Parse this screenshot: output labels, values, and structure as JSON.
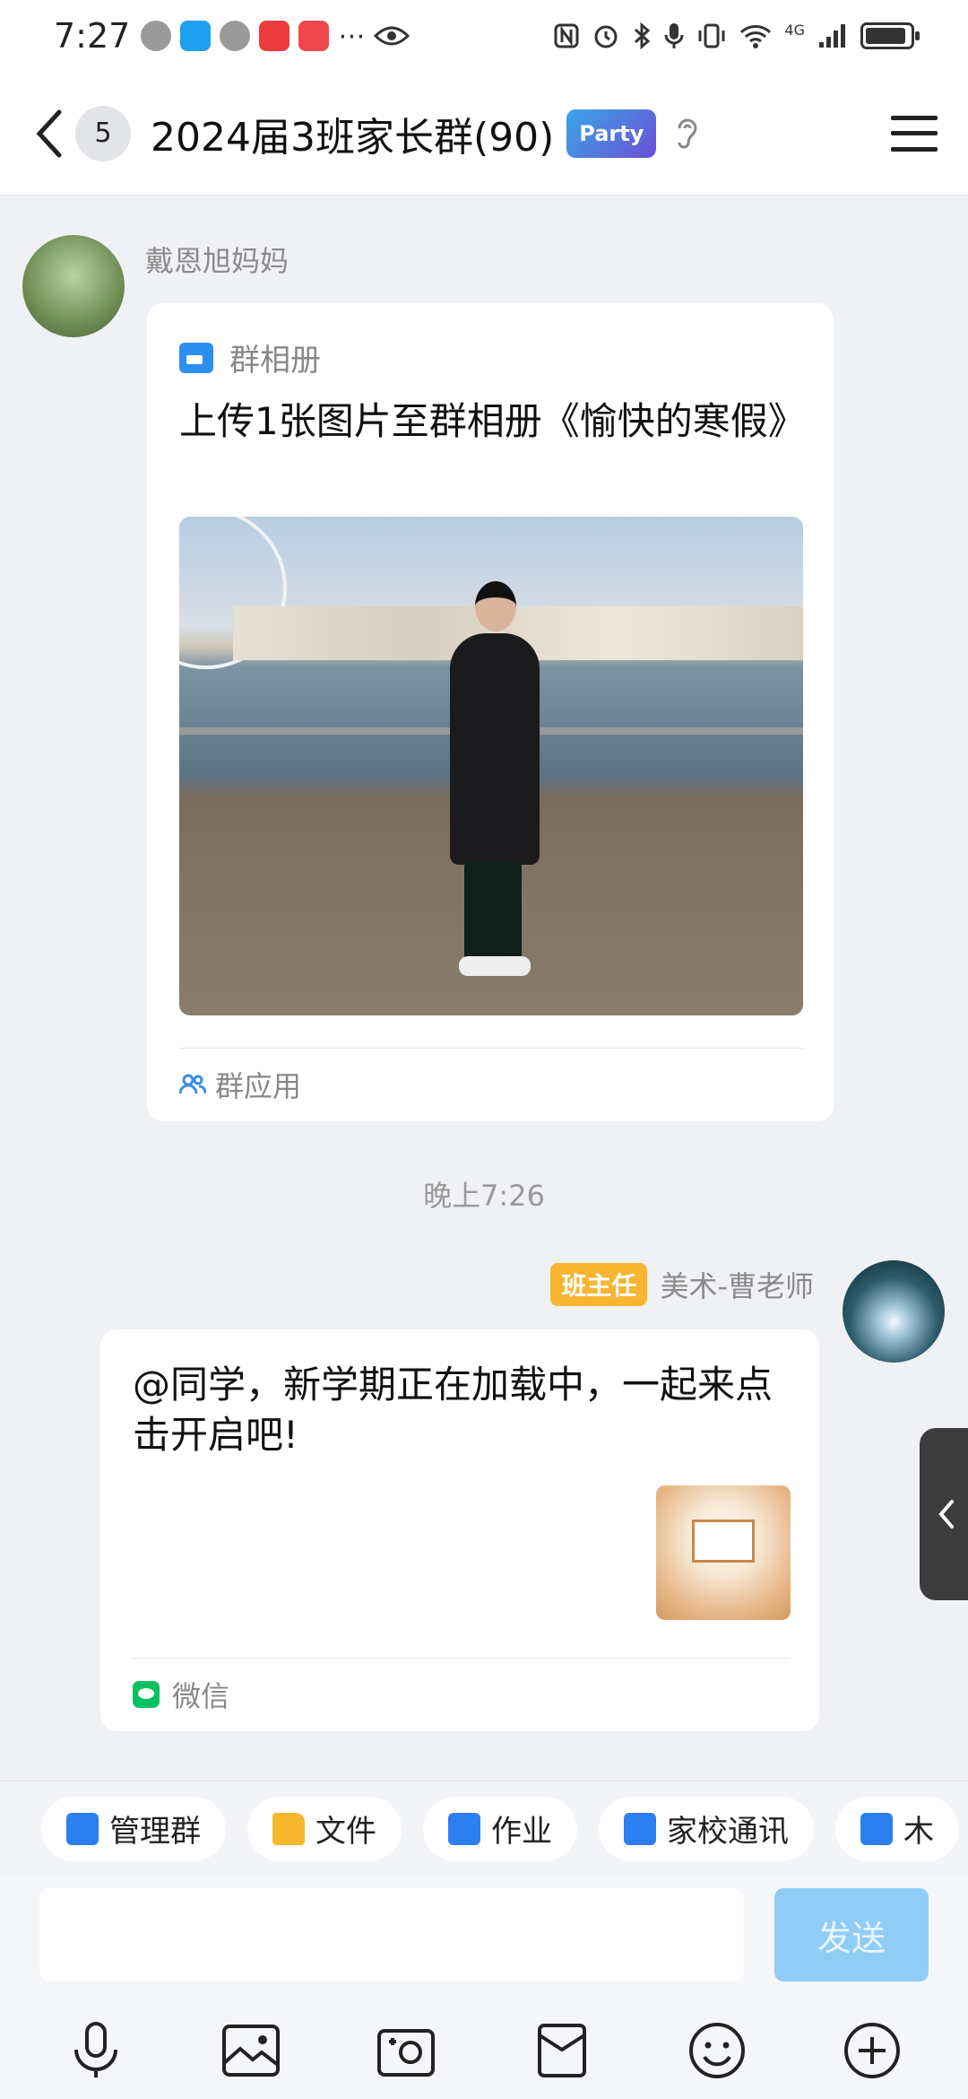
{
  "status_bar": {
    "time": "7:27",
    "right_text": "⋯",
    "network": "4G"
  },
  "nav": {
    "unread_count": "5",
    "title": "2024届3班家长群(90)",
    "badge_text": "Party"
  },
  "messages": {
    "album": {
      "sender": "戴恩旭妈妈",
      "header_label": "群相册",
      "text": "上传1张图片至群相册《愉快的寒假》",
      "footer_label": "群应用"
    },
    "timestamp": "晚上7:26",
    "share": {
      "role_badge": "班主任",
      "sender": "美术-曹老师",
      "text": "@同学，新学期正在加载中，一起来点击开启吧!",
      "footer_label": "微信"
    }
  },
  "quick_actions": [
    {
      "label": "管理群",
      "icon": "manage-group-icon"
    },
    {
      "label": "文件",
      "icon": "folder-icon"
    },
    {
      "label": "作业",
      "icon": "homework-icon"
    },
    {
      "label": "家校通讯",
      "icon": "contacts-icon"
    },
    {
      "label": "木",
      "icon": "album-icon"
    }
  ],
  "composer": {
    "placeholder": "",
    "send_label": "发送"
  },
  "toolbar_icons": [
    "microphone-icon",
    "image-icon",
    "camera-icon",
    "red-packet-icon",
    "emoji-icon",
    "plus-icon"
  ],
  "colors": {
    "accent": "#2b8ef0",
    "send_disabled": "#8fcdf7",
    "role_badge": "#f7b531",
    "background": "#f0f1f5"
  }
}
